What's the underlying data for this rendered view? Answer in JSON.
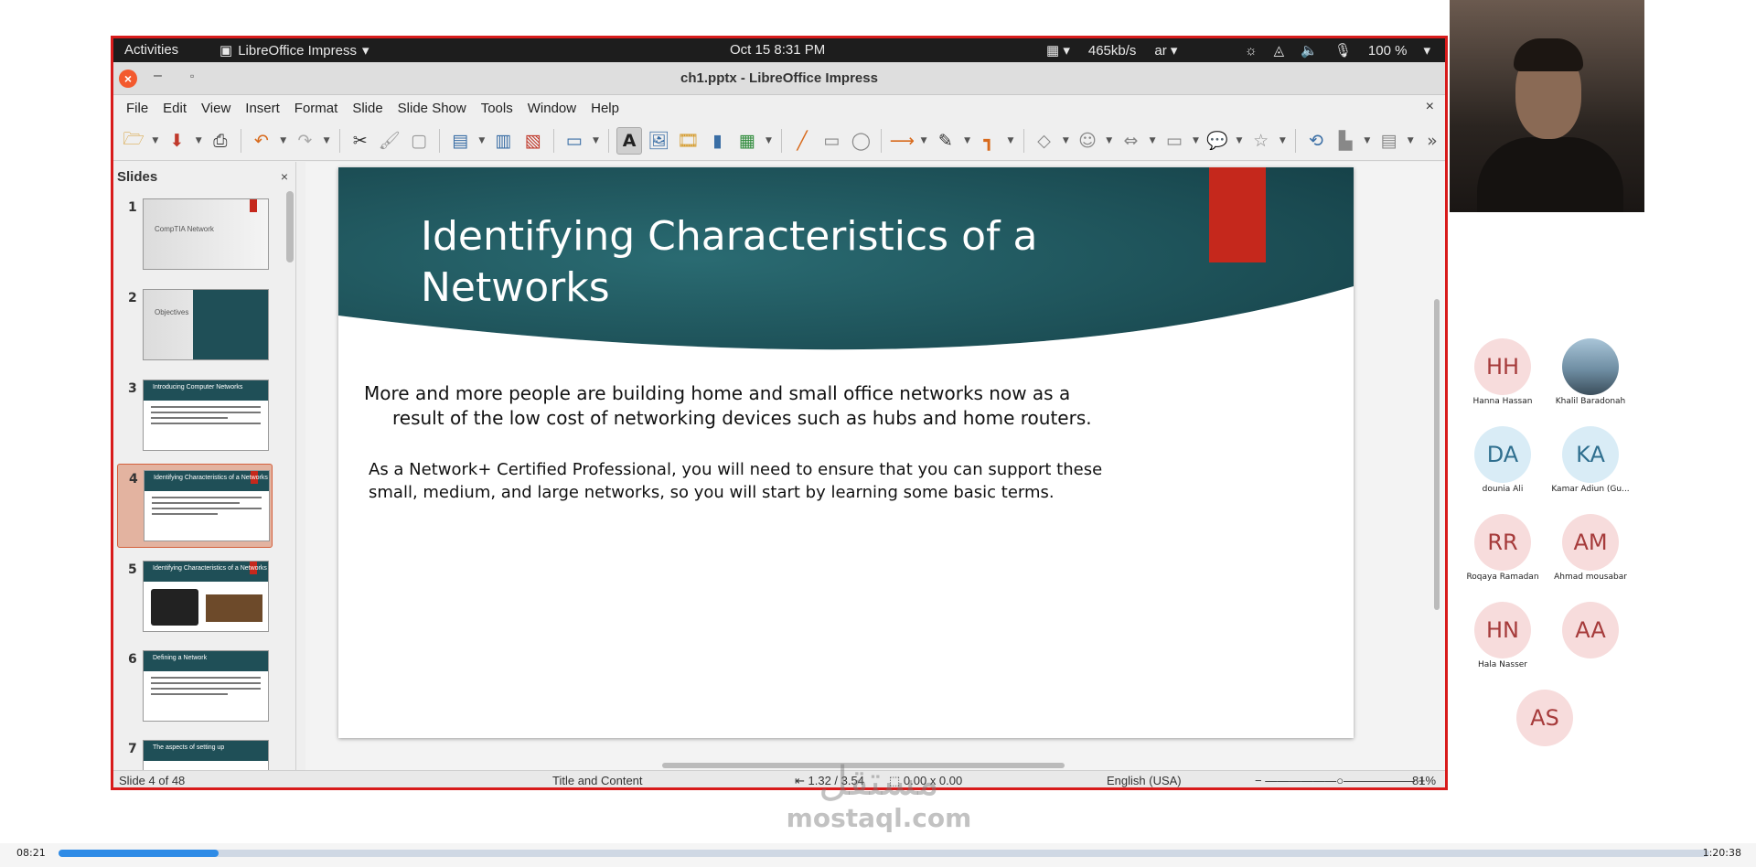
{
  "topbar": {
    "activities": "Activities",
    "app_name": "LibreOffice Impress",
    "clock": "Oct 15  8:31 PM",
    "net_speed": "465kb/s",
    "keyboard": "ar",
    "battery": "100 %"
  },
  "window": {
    "title": "ch1.pptx - LibreOffice Impress"
  },
  "menu": [
    "File",
    "Edit",
    "View",
    "Insert",
    "Format",
    "Slide",
    "Slide Show",
    "Tools",
    "Window",
    "Help"
  ],
  "slides_panel": {
    "title": "Slides",
    "thumbs": [
      {
        "num": "1",
        "label": "CompTIA    Network"
      },
      {
        "num": "2",
        "label": "Objectives"
      },
      {
        "num": "3",
        "label": "Introducing Computer Networks"
      },
      {
        "num": "4",
        "label": "Identifying Characteristics of a Networks"
      },
      {
        "num": "5",
        "label": "Identifying Characteristics of a Networks"
      },
      {
        "num": "6",
        "label": "Defining a Network"
      },
      {
        "num": "7",
        "label": "The aspects of setting up"
      }
    ]
  },
  "slide": {
    "title": "Identifying Characteristics of a Networks",
    "para1": "More and more people are building home and small office networks now as a result of the low cost of networking devices such as hubs and home routers.",
    "para2": "As a Network+ Certified Professional, you will need to ensure that you can support these small, medium, and large networks, so you will start by learning some basic terms."
  },
  "statusbar": {
    "slide_pos": "Slide 4 of 48",
    "layout": "Title and Content",
    "position": "1.32 / 3.54",
    "size": "0.00 x 0.00",
    "language": "English (USA)",
    "zoom": "81%"
  },
  "participants": [
    {
      "initials": "HH",
      "name": "Hanna Hassan",
      "style": "pink"
    },
    {
      "initials": "",
      "name": "Khalil Baradonah",
      "style": "photo"
    },
    {
      "initials": "DA",
      "name": "dounia Ali",
      "style": "blue"
    },
    {
      "initials": "KA",
      "name": "Kamar Adiun (Gu...",
      "style": "blue"
    },
    {
      "initials": "RR",
      "name": "Roqaya Ramadan",
      "style": "pink"
    },
    {
      "initials": "AM",
      "name": "Ahmad mousabar",
      "style": "pink"
    },
    {
      "initials": "HN",
      "name": "Hala Nasser",
      "style": "pink"
    },
    {
      "initials": "AA",
      "name": "",
      "style": "pink"
    },
    {
      "initials": "AS",
      "name": "",
      "style": "pink"
    }
  ],
  "watermark": {
    "arabic": "مستقل",
    "latin": "mostaql.com"
  },
  "player": {
    "current": "08:21",
    "total": "1:20:38",
    "progress": 0.0968
  },
  "colors": {
    "accent_red": "#c5281c",
    "slide_teal": "#1f4f57",
    "frame_red": "#d81b1b",
    "progress_blue": "#2e8be6"
  }
}
